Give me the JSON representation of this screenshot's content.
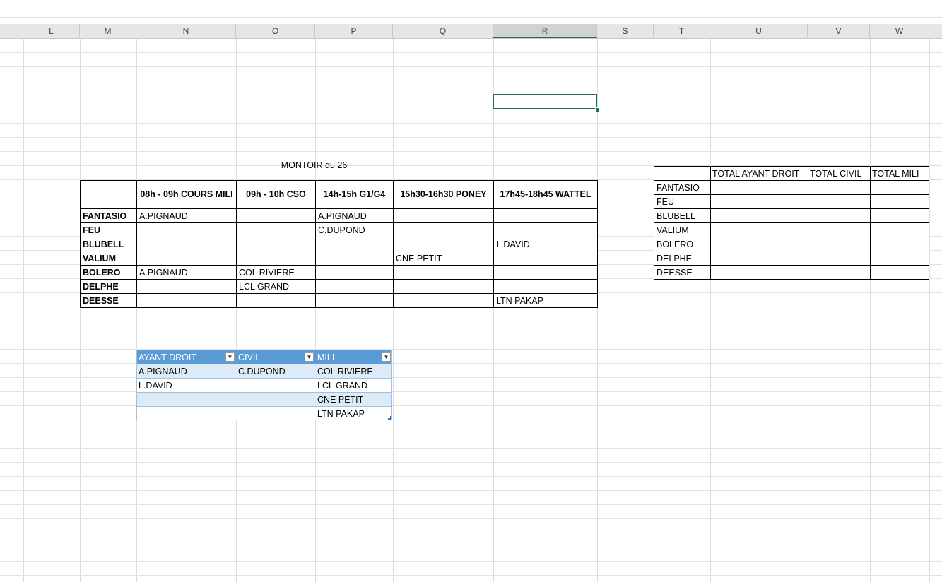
{
  "columns": [
    "L",
    "M",
    "N",
    "O",
    "P",
    "Q",
    "R",
    "S",
    "T",
    "U",
    "V",
    "W"
  ],
  "selected_column": "R",
  "planning": {
    "title": "MONTOIR du 26",
    "headers": [
      "08h - 09h COURS MILI",
      "09h - 10h CSO",
      "14h-15h G1/G4",
      "15h30-16h30 PONEY",
      "17h45-18h45 WATTEL"
    ],
    "rows": [
      {
        "horse": "FANTASIO",
        "cells": [
          "A.PIGNAUD",
          "",
          "A.PIGNAUD",
          "",
          ""
        ]
      },
      {
        "horse": "FEU",
        "cells": [
          "",
          "",
          "C.DUPOND",
          "",
          ""
        ]
      },
      {
        "horse": "BLUBELL",
        "cells": [
          "",
          "",
          "",
          "",
          "L.DAVID"
        ]
      },
      {
        "horse": "VALIUM",
        "cells": [
          "",
          "",
          "",
          "CNE PETIT",
          ""
        ]
      },
      {
        "horse": "BOLERO",
        "cells": [
          "A.PIGNAUD",
          "COL RIVIERE",
          "",
          "",
          ""
        ]
      },
      {
        "horse": "DELPHE",
        "cells": [
          "",
          "LCL GRAND",
          "",
          "",
          ""
        ]
      },
      {
        "horse": "DEESSE",
        "cells": [
          "",
          "",
          "",
          "",
          "LTN PAKAP"
        ]
      }
    ]
  },
  "category_table": {
    "headers": [
      "AYANT DROIT",
      "CIVIL",
      "MILI"
    ],
    "rows": [
      [
        "A.PIGNAUD",
        "C.DUPOND",
        "COL RIVIERE"
      ],
      [
        "L.DAVID",
        "",
        "LCL GRAND"
      ],
      [
        "",
        "",
        "CNE PETIT"
      ],
      [
        "",
        "",
        "LTN PAKAP"
      ]
    ]
  },
  "totals": {
    "headers": [
      "TOTAL AYANT DROIT",
      "TOTAL CIVIL",
      "TOTAL MILI"
    ],
    "horses": [
      "FANTASIO",
      "FEU",
      "BLUBELL",
      "VALIUM",
      "BOLERO",
      "DELPHE",
      "DEESSE"
    ]
  },
  "icons": {
    "filter_dropdown": "chevron-down-icon"
  },
  "colors": {
    "table_header": "#5b9bd5",
    "table_band": "#ddebf7",
    "selection": "#217346"
  }
}
